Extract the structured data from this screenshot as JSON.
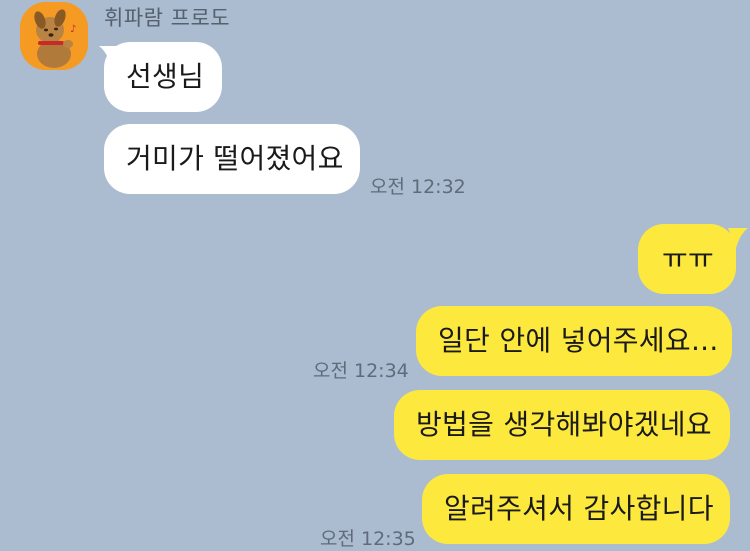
{
  "chat": {
    "sender_name": "휘파람 프로도",
    "incoming": [
      {
        "text": "선생님"
      },
      {
        "text": "거미가 떨어졌어요"
      }
    ],
    "incoming_time": "오전 12:32",
    "outgoing": [
      {
        "text": "ㅠㅠ"
      },
      {
        "text": "일단 안에 넣어주세요..."
      },
      {
        "text": "방법을 생각해봐야겠네요"
      },
      {
        "text": "알려주셔서 감사합니다"
      }
    ],
    "outgoing_times": [
      "오전 12:34",
      "오전 12:35"
    ]
  },
  "colors": {
    "background": "#abbcd0",
    "incoming_bubble": "#ffffff",
    "outgoing_bubble": "#fde93e",
    "avatar_bg": "#f59a23"
  },
  "icons": {
    "avatar": "frodo-dog-avatar-icon"
  }
}
